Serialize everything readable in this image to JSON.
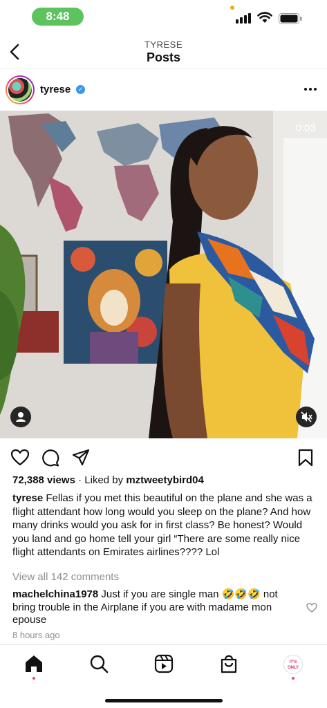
{
  "status_bar": {
    "time": "8:48"
  },
  "header": {
    "subtitle": "TYRESE",
    "title": "Posts"
  },
  "post": {
    "username": "tyrese",
    "video_timer": "0:03",
    "views": "72,388 views",
    "separator": "·",
    "liked_by_prefix": "Liked by",
    "liked_by_user": "mztweetybird04",
    "caption_user": "tyrese",
    "caption_text": "Fellas if you met this beautiful on the plane and she was a flight attendant how long would you sleep on the plane? And how many drinks would you ask for in first class? Be honest? Would you land and go home tell your girl “There are some really nice flight attendants on Emirates airlines???? Lol",
    "view_all_comments": "View all 142 comments",
    "comment_user": "machelchina1978",
    "comment_text": "Just if you are single man 🤣🤣🤣 not bring trouble in the Airplane if you are with madame mon epouse",
    "time_ago": "8 hours ago"
  },
  "tabbar": {
    "profile_badge": "IT'S ONLY"
  },
  "colors": {
    "accent_blue": "#3897f0",
    "notification_red": "#ed4956",
    "status_green": "#5cc35f"
  },
  "icons": [
    "back-icon",
    "verified-icon",
    "more-icon",
    "user-tag-icon",
    "mute-icon",
    "heart-icon",
    "comment-icon",
    "share-icon",
    "bookmark-icon",
    "home-icon",
    "search-icon",
    "reels-icon",
    "shop-icon"
  ]
}
